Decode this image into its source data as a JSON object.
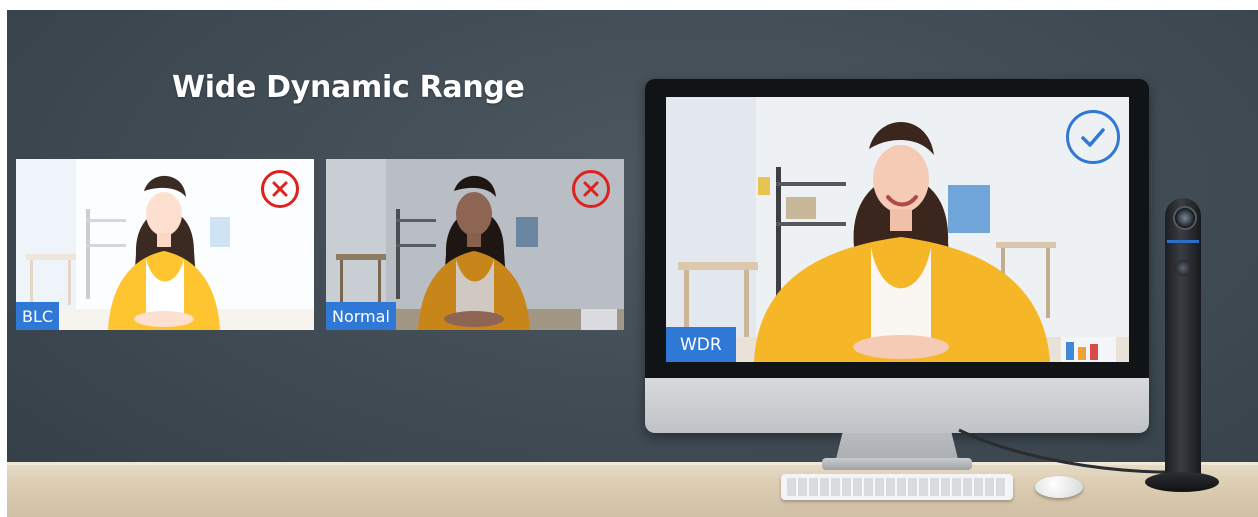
{
  "title": "Wide Dynamic Range",
  "panels": [
    {
      "label": "BLC",
      "status": "rejected",
      "status_icon": "x-circle-icon"
    },
    {
      "label": "Normal",
      "status": "rejected",
      "status_icon": "x-circle-icon"
    },
    {
      "label": "WDR",
      "status": "approved",
      "status_icon": "check-circle-icon"
    }
  ],
  "colors": {
    "label_bg": "#2f78d6",
    "reject": "#e0201d",
    "approve": "#2f78d6",
    "background": "#3f4a53"
  }
}
